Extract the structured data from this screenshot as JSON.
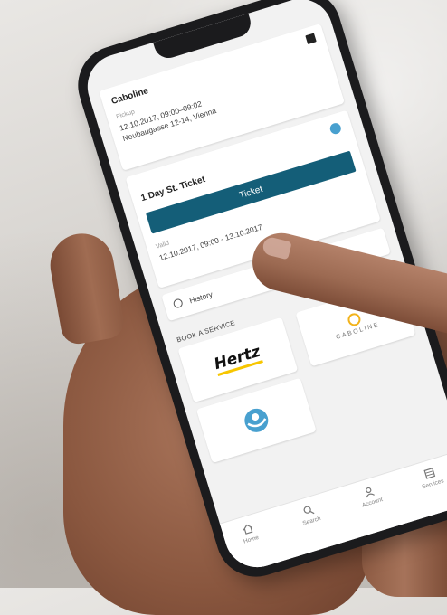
{
  "app": {
    "header_card": {
      "title": "Caboline",
      "pickup_label": "Pickup",
      "pickup_time": "12.10.2017, 09:00–09:02",
      "pickup_address": "Neubaugasse 12-14, Vienna"
    },
    "ticket_card": {
      "title": "1 Day St. Ticket",
      "button_label": "Ticket",
      "valid_label": "Valid",
      "valid_range": "12.10.2017, 09:00 - 13.10.2017"
    },
    "history": {
      "label": "History"
    },
    "services": {
      "section_label": "BOOK A SERVICE",
      "hertz_label": "Hertz",
      "caboline_label": "CABOLINE"
    },
    "tabbar": {
      "tabs": [
        {
          "label": "Home",
          "icon": "home-icon"
        },
        {
          "label": "Search",
          "icon": "search-icon"
        },
        {
          "label": "Account",
          "icon": "account-icon"
        },
        {
          "label": "Services",
          "icon": "services-icon"
        }
      ]
    }
  },
  "colors": {
    "ticket_button": "#145e78",
    "hertz_yellow": "#f7c600",
    "caboline_yellow": "#f2b31b",
    "wl_blue": "#48a0cf"
  }
}
